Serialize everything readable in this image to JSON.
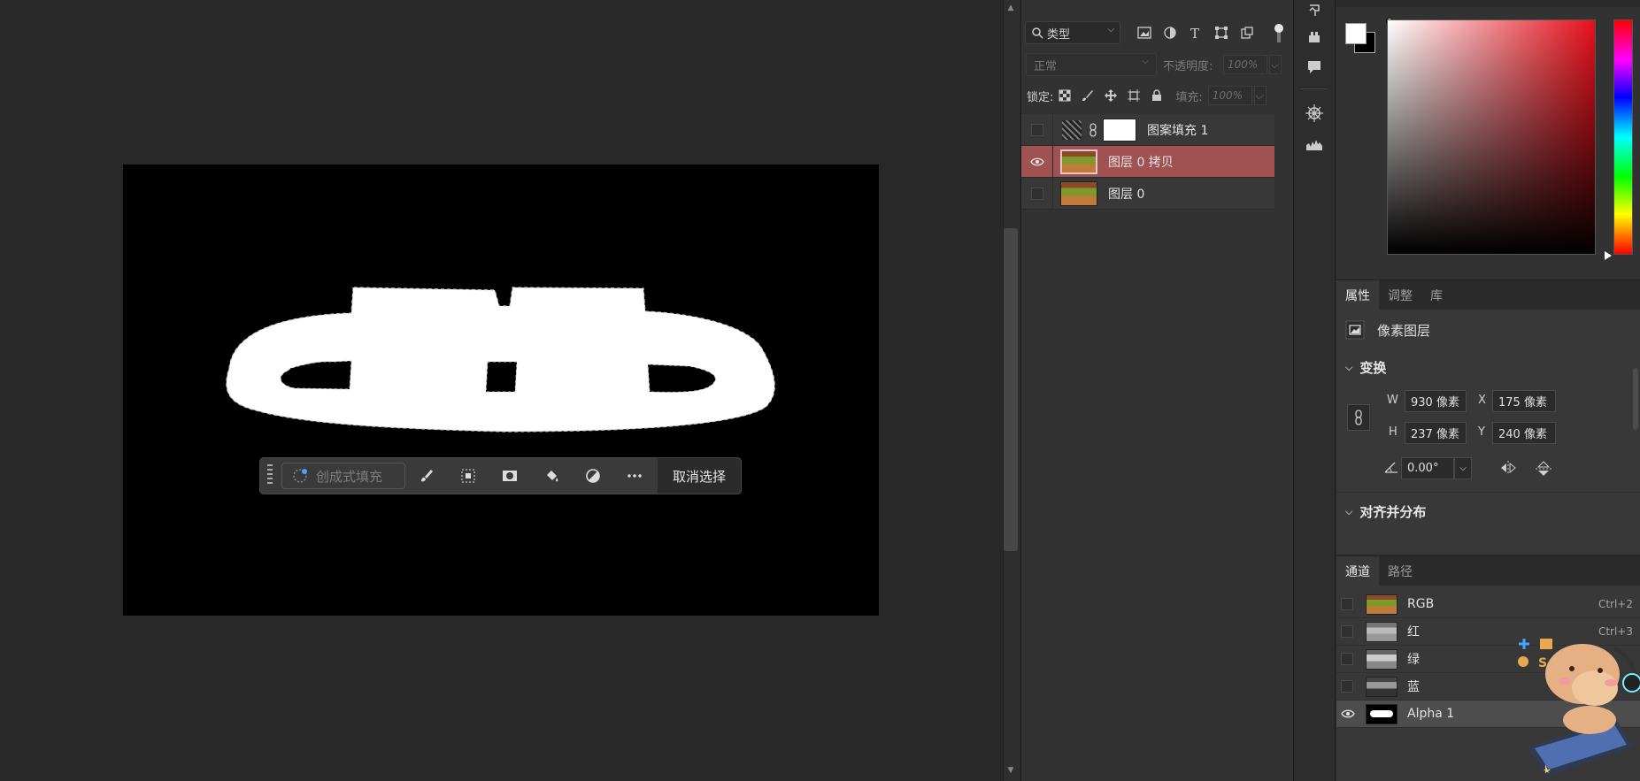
{
  "canvas_toolbar": {
    "generative_fill_placeholder": "创成式填充",
    "deselect_label": "取消选择"
  },
  "layers_panel": {
    "kind_filter": "类型",
    "blend_mode": "正常",
    "opacity_label": "不透明度:",
    "opacity_value": "100%",
    "lock_label": "锁定:",
    "fill_label": "填充:",
    "fill_value": "100%",
    "layers": [
      {
        "name": "图案填充 1",
        "visible": false,
        "selected": false
      },
      {
        "name": "图层 0 拷贝",
        "visible": true,
        "selected": true
      },
      {
        "name": "图层 0",
        "visible": false,
        "selected": false
      }
    ]
  },
  "properties_panel": {
    "tabs": [
      "属性",
      "调整",
      "库"
    ],
    "active_tab": "属性",
    "layer_type": "像素图层",
    "transform_title": "变换",
    "w_label": "W",
    "w_value": "930 像素",
    "x_label": "X",
    "x_value": "175 像素",
    "h_label": "H",
    "h_value": "237 像素",
    "y_label": "Y",
    "y_value": "240 像素",
    "angle_value": "0.00°",
    "align_title": "对齐并分布"
  },
  "channels_panel": {
    "tabs": [
      "通道",
      "路径"
    ],
    "active_tab": "通道",
    "channels": [
      {
        "name": "RGB",
        "shortcut": "Ctrl+2",
        "visible": false
      },
      {
        "name": "红",
        "shortcut": "Ctrl+3",
        "visible": false
      },
      {
        "name": "绿",
        "shortcut": "",
        "visible": false
      },
      {
        "name": "蓝",
        "shortcut": "",
        "visible": false
      },
      {
        "name": "Alpha 1",
        "shortcut": "",
        "visible": true
      }
    ]
  },
  "colors": {
    "selected_layer": "#a05253",
    "panel_bg": "#383838",
    "canvas": "#000000"
  }
}
